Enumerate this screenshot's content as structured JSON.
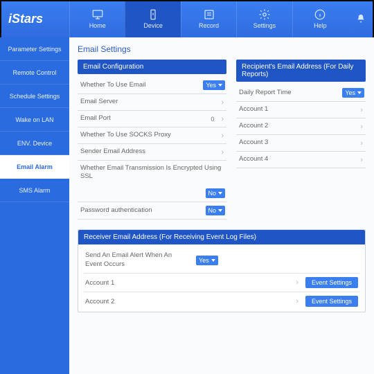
{
  "brand": "iStars",
  "topnav": [
    {
      "label": "Home",
      "icon": "monitor"
    },
    {
      "label": "Device",
      "icon": "device",
      "active": true
    },
    {
      "label": "Record",
      "icon": "record"
    },
    {
      "label": "Settings",
      "icon": "gear"
    },
    {
      "label": "Help",
      "icon": "info"
    }
  ],
  "sidebar": [
    {
      "label": "Parameter Settings"
    },
    {
      "label": "Remote Control"
    },
    {
      "label": "Schedule Settings"
    },
    {
      "label": "Wake on LAN"
    },
    {
      "label": "ENV. Device"
    },
    {
      "label": "Email Alarm",
      "active": true
    },
    {
      "label": "SMS Alarm"
    }
  ],
  "page_title": "Email Settings",
  "email_config": {
    "header": "Email Configuration",
    "rows": [
      {
        "label": "Whether To Use Email",
        "ctrl": "select",
        "value": "Yes"
      },
      {
        "label": "Email Server",
        "ctrl": "chev"
      },
      {
        "label": "Email Port",
        "ctrl": "num_chev",
        "value": "0"
      },
      {
        "label": "Whether To Use SOCKS Proxy",
        "ctrl": "chev"
      },
      {
        "label": "Sender Email Address",
        "ctrl": "chev"
      },
      {
        "label": "Whether Email Transmission Is Encrypted Using SSL",
        "ctrl": "select_below",
        "value": "No"
      },
      {
        "label": "Password authentication",
        "ctrl": "select",
        "value": "No"
      }
    ]
  },
  "recipients": {
    "header": "Recipient's Email Address (For Daily Reports)",
    "rows": [
      {
        "label": "Daily Report Time",
        "ctrl": "select",
        "value": "Yes"
      },
      {
        "label": "Account 1",
        "ctrl": "chev"
      },
      {
        "label": "Account 2",
        "ctrl": "chev"
      },
      {
        "label": "Account 3",
        "ctrl": "chev"
      },
      {
        "label": "Account 4",
        "ctrl": "chev"
      }
    ]
  },
  "receiver": {
    "header": "Receiver Email Address (For Receiving Event Log Files)",
    "alert_label": "Send An Email Alert When An Event Occurs",
    "alert_value": "Yes",
    "accounts": [
      {
        "label": "Account 1",
        "btn": "Event Settings"
      },
      {
        "label": "Account 2",
        "btn": "Event Settings"
      }
    ]
  }
}
